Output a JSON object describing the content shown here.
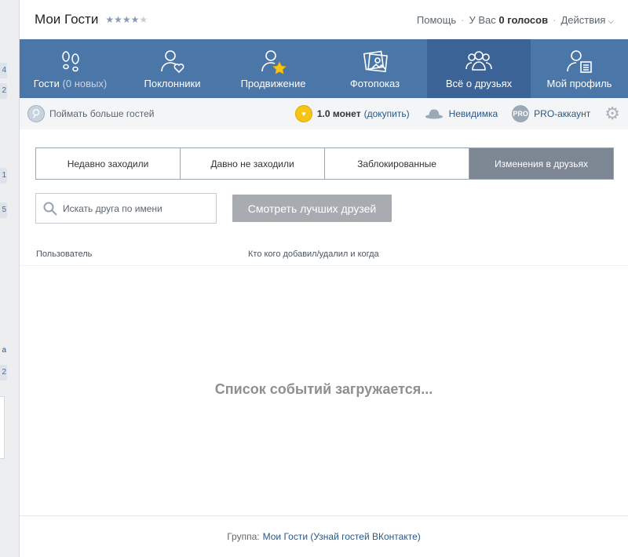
{
  "header": {
    "title": "Мои Гости",
    "stars_on": "★★★★",
    "stars_off": "★",
    "help": "Помощь",
    "votes_prefix": "У Вас",
    "votes_value": "0 голосов",
    "actions": "Действия"
  },
  "nav": {
    "items": [
      {
        "label": "Гости",
        "sub": "(0 новых)"
      },
      {
        "label": "Поклонники"
      },
      {
        "label": "Продвижение"
      },
      {
        "label": "Фотопоказ"
      },
      {
        "label": "Всё о друзьях"
      },
      {
        "label": "Мой профиль"
      }
    ]
  },
  "toolbar": {
    "catch": "Поймать больше гостей",
    "coins": "1.0 монет",
    "buy": "(докупить)",
    "invisible": "Невидимка",
    "pro_badge": "PRO",
    "pro": "PRO-аккаунт"
  },
  "tabs": [
    "Недавно заходили",
    "Давно не заходили",
    "Заблокированные",
    "Изменения в друзьях"
  ],
  "search": {
    "placeholder": "Искать друга по имени"
  },
  "best_button": "Смотреть лучших друзей",
  "table": {
    "col1": "Пользователь",
    "col2": "Кто кого добавил/удалил и когда"
  },
  "loading": "Список событий загружается...",
  "footer": {
    "prefix": "Группа:",
    "link": "Мои Гости (Узнай гостей ВКонтакте)"
  },
  "left_stubs": [
    "4",
    "2",
    "1",
    "5",
    "а",
    "2"
  ],
  "colors": {
    "nav_bg": "#4a76a8",
    "nav_active": "#3b6395",
    "tab_active": "#7d8793",
    "button": "#a8acb1",
    "link": "#2a5885"
  }
}
